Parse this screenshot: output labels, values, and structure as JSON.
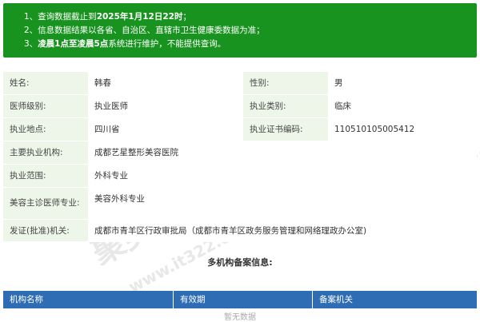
{
  "notice": {
    "line1_prefix": "1、查询数据截止到",
    "line1_bold": "2025年1月12日22时",
    "line1_suffix": "；",
    "line2": "2、信息数据结果以各省、自治区、直辖市卫生健康委数据为准；",
    "line3_prefix": "3、",
    "line3_bold1": "凌晨1点至凌晨5点",
    "line3_suffix": "系统进行维护，不能提供查询。"
  },
  "info": {
    "name_label": "姓名:",
    "name_value": "韩春",
    "gender_label": "性别:",
    "gender_value": "男",
    "level_label": "医师级别:",
    "level_value": "执业医师",
    "category_label": "执业类别:",
    "category_value": "临床",
    "location_label": "执业地点:",
    "location_value": "四川省",
    "cert_label": "执业证书编码:",
    "cert_value": "110510105005412",
    "org_label": "主要执业机构:",
    "org_value": "成都艺星整形美容医院",
    "scope_label": "执业范围:",
    "scope_value": "外科专业",
    "cosmetic_label": "美容主诊医师专业:",
    "cosmetic_value": "美容外科专业",
    "issuer_label": "发证(批准)机关:",
    "issuer_value": "成都市青羊区行政审批局（成都市青羊区政务服务管理和网络理政办公室)"
  },
  "multi_org": {
    "title": "多机构备案信息:",
    "columns": [
      "机构名称",
      "有效期",
      "备案机关"
    ],
    "empty_text": "暂无数据"
  },
  "watermark": {
    "text_cn": "聚美网",
    "text_url": "www.it322.com.cn"
  }
}
